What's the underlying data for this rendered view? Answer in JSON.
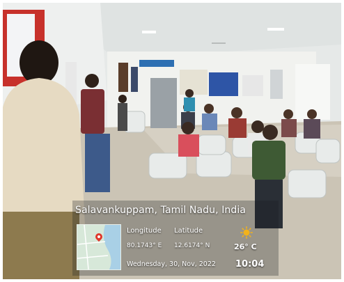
{
  "geotag": {
    "location": "Salavankuppam, Tamil Nadu, India",
    "longitude_label": "Longitude",
    "latitude_label": "Latitude",
    "longitude_value": "80.1743° E",
    "latitude_value": "12.6174° N",
    "date": "Wednesday, 30, Nov, 2022",
    "temperature": "26° C",
    "time": "10:04",
    "weather_icon": "sun-icon",
    "map_icon": "map-thumbnail"
  },
  "colors": {
    "wall": "#e9ecea",
    "floor": "#c9c2b4",
    "chair": "#e8ebea",
    "pin": "#e0372b",
    "sun": "#f2b21b"
  }
}
